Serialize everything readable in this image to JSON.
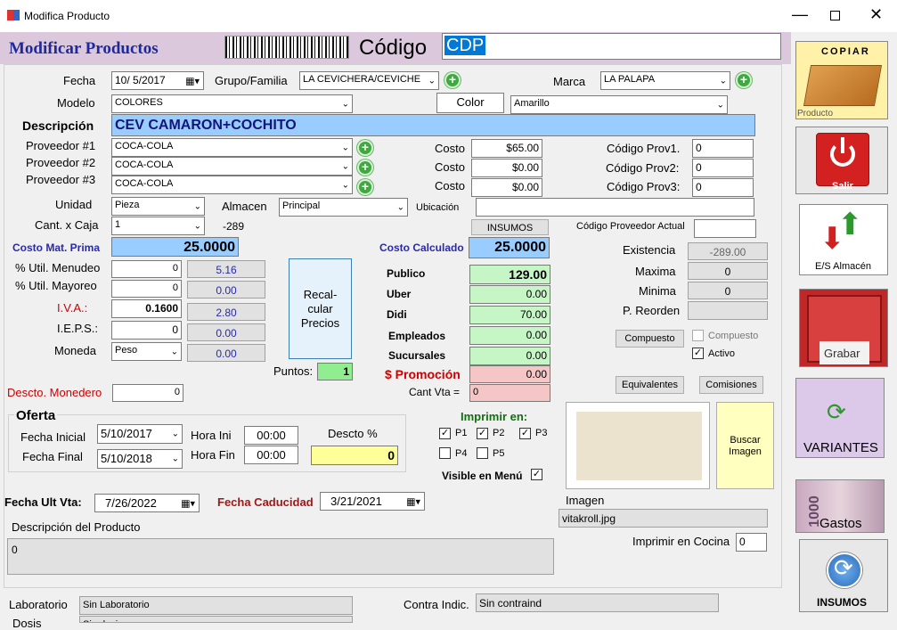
{
  "window": {
    "title": "Modifica Producto"
  },
  "header": {
    "title": "Modificar Productos",
    "codigo_label": "Código",
    "codigo_value": "CDP"
  },
  "form": {
    "fecha_label": "Fecha",
    "fecha": "10/ 5/2017",
    "grupo_label": "Grupo/Familia",
    "grupo": "LA CEVICHERA/CEVICHE",
    "marca_label": "Marca",
    "marca": "LA PALAPA",
    "modelo_label": "Modelo",
    "modelo": "COLORES",
    "color_label": "Color",
    "color": "Amarillo",
    "descripcion_label": "Descripción",
    "descripcion": "CEV CAMARON+COCHITO",
    "prov1_label": "Proveedor #1",
    "prov1": "COCA-COLA",
    "prov2_label": "Proveedor #2",
    "prov2": "COCA-COLA",
    "prov3_label": "Proveedor #3",
    "prov3": "COCA-COLA",
    "costo_label": "Costo",
    "costo1": "$65.00",
    "costo2": "$0.00",
    "costo3": "$0.00",
    "codprov1_label": "Código Prov1.",
    "codprov1": "0",
    "codprov2_label": "Código Prov2:",
    "codprov2": "0",
    "codprov3_label": "Código Prov3:",
    "codprov3": "0",
    "unidad_label": "Unidad",
    "unidad": "Pieza",
    "almacen_label": "Almacen",
    "almacen": "Principal",
    "ubicacion_label": "Ubicación",
    "ubicacion": "",
    "cantcaja_label": "Cant. x Caja",
    "cantcaja": "1",
    "cantcaja_extra": "-289",
    "insumos_label": "INSUMOS",
    "codprovactual_label": "Código Proveedor Actual",
    "codprovactual": "",
    "costomat_label": "Costo Mat. Prima",
    "costomat": "25.0000",
    "costocalc_label": "Costo Calculado",
    "costocalc": "25.0000",
    "existencia_label": "Existencia",
    "existencia": "-289.00",
    "maxima_label": "Maxima",
    "maxima": "0",
    "minima_label": "Minima",
    "minima": "0",
    "preorden_label": "P. Reorden",
    "preorden": "",
    "utilmen_label": "% Util. Menudeo",
    "utilmen": "0",
    "utilmen_calc": "5.16",
    "utilmay_label": "% Util. Mayoreo",
    "utilmay": "0",
    "utilmay_calc": "0.00",
    "iva_label": "I.V.A.:",
    "iva": "0.1600",
    "iva_calc": "2.80",
    "ieps_label": "I.E.P.S.:",
    "ieps": "0",
    "ieps_calc": "0.00",
    "moneda_label": "Moneda",
    "moneda": "Peso",
    "moneda_calc": "0.00",
    "recalcular": "Recal-\ncular\nPrecios",
    "puntos_label": "Puntos:",
    "puntos": "1",
    "publico_label": "Publico",
    "publico": "129.00",
    "uber_label": "Uber",
    "uber": "0.00",
    "didi_label": "Didi",
    "didi": "70.00",
    "empleados_label": "Empleados",
    "empleados": "0.00",
    "sucursales_label": "Sucursales",
    "sucursales": "0.00",
    "promocion_label": "$ Promoción",
    "promocion": "0.00",
    "cantvta_label": "Cant Vta =",
    "cantvta": "0",
    "compuesto_btn": "Compuesto",
    "compuesto_chk": "Compuesto",
    "activo_chk": "Activo",
    "equivalentes": "Equivalentes",
    "comisiones": "Comisiones",
    "monedero_label": "Descto. Monedero",
    "monedero": "0",
    "oferta_label": "Oferta",
    "fechaini_label": "Fecha Inicial",
    "fechaini": "5/10/2017",
    "fechafin_label": "Fecha Final",
    "fechafin": "5/10/2018",
    "horaini_label": "Hora Ini",
    "horaini": "00:00",
    "horafin_label": "Hora Fin",
    "horafin": "00:00",
    "descto_label": "Descto %",
    "descto": "0",
    "imprimir_label": "Imprimir en:",
    "p1": "P1",
    "p2": "P2",
    "p3": "P3",
    "p4": "P4",
    "p5": "P5",
    "visible_label": "Visible en Menú",
    "buscar_imagen": "Buscar\nImagen",
    "imagen_label": "Imagen",
    "imagen": "vitakroll.jpg",
    "fechault_label": "Fecha Ult Vta:",
    "fechault": "7/26/2022",
    "caducidad_label": "Fecha Caducidad",
    "caducidad": "3/21/2021",
    "desc_prod_label": "Descripción del Producto",
    "desc_prod": "0",
    "cocina_label": "Imprimir en Cocina",
    "cocina": "0",
    "laboratorio_label": "Laboratorio",
    "laboratorio": "Sin Laboratorio",
    "contra_label": "Contra Indic.",
    "contra": "Sin contraind",
    "dosis_label": "Dosis",
    "dosis": "Sin dosis"
  },
  "sidebar": {
    "copiar": "COPIAR",
    "producto": "Producto",
    "salir": "Salir",
    "es_almacen": "E/S Almacén",
    "grabar": "Grabar",
    "variantes": "VARIANTES",
    "gastos": "Gastos",
    "insumos": "INSUMOS"
  },
  "colors": {
    "title_blue": "#1e2a9c",
    "desc_bg": "#99ccff",
    "green_bg": "#c6f5c6",
    "pink_bg": "#f5c6c6",
    "yellow_bg": "#ffff99"
  }
}
